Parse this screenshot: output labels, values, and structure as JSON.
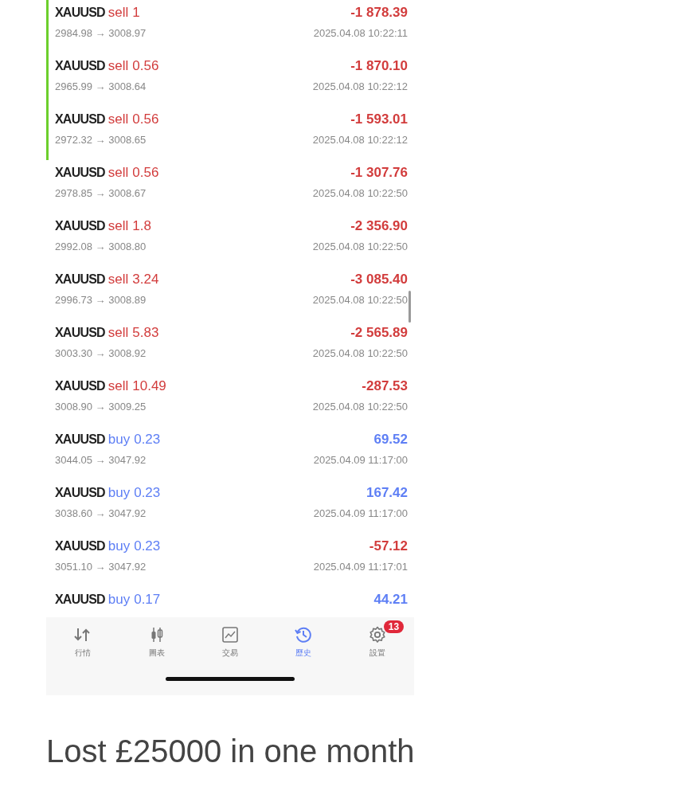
{
  "trades": [
    {
      "symbol": "XAUUSD",
      "side": "sell",
      "volume": "1",
      "profit": "-1 878.39",
      "loss": true,
      "prices": "2984.98 → 3008.97",
      "time": "2025.04.08 10:22:11",
      "flagged": true
    },
    {
      "symbol": "XAUUSD",
      "side": "sell",
      "volume": "0.56",
      "profit": "-1 870.10",
      "loss": true,
      "prices": "2965.99 → 3008.64",
      "time": "2025.04.08 10:22:12",
      "flagged": true
    },
    {
      "symbol": "XAUUSD",
      "side": "sell",
      "volume": "0.56",
      "profit": "-1 593.01",
      "loss": true,
      "prices": "2972.32 → 3008.65",
      "time": "2025.04.08 10:22:12",
      "flagged": true
    },
    {
      "symbol": "XAUUSD",
      "side": "sell",
      "volume": "0.56",
      "profit": "-1 307.76",
      "loss": true,
      "prices": "2978.85 → 3008.67",
      "time": "2025.04.08 10:22:50",
      "flagged": false
    },
    {
      "symbol": "XAUUSD",
      "side": "sell",
      "volume": "1.8",
      "profit": "-2 356.90",
      "loss": true,
      "prices": "2992.08 → 3008.80",
      "time": "2025.04.08 10:22:50",
      "flagged": false
    },
    {
      "symbol": "XAUUSD",
      "side": "sell",
      "volume": "3.24",
      "profit": "-3 085.40",
      "loss": true,
      "prices": "2996.73 → 3008.89",
      "time": "2025.04.08 10:22:50",
      "flagged": false
    },
    {
      "symbol": "XAUUSD",
      "side": "sell",
      "volume": "5.83",
      "profit": "-2 565.89",
      "loss": true,
      "prices": "3003.30 → 3008.92",
      "time": "2025.04.08 10:22:50",
      "flagged": false
    },
    {
      "symbol": "XAUUSD",
      "side": "sell",
      "volume": "10.49",
      "profit": "-287.53",
      "loss": true,
      "prices": "3008.90 → 3009.25",
      "time": "2025.04.08 10:22:50",
      "flagged": false
    },
    {
      "symbol": "XAUUSD",
      "side": "buy",
      "volume": "0.23",
      "profit": "69.52",
      "loss": false,
      "prices": "3044.05 → 3047.92",
      "time": "2025.04.09 11:17:00",
      "flagged": false
    },
    {
      "symbol": "XAUUSD",
      "side": "buy",
      "volume": "0.23",
      "profit": "167.42",
      "loss": false,
      "prices": "3038.60 → 3047.92",
      "time": "2025.04.09 11:17:00",
      "flagged": false
    },
    {
      "symbol": "XAUUSD",
      "side": "buy",
      "volume": "0.23",
      "profit": "-57.12",
      "loss": true,
      "prices": "3051.10 → 3047.92",
      "time": "2025.04.09 11:17:01",
      "flagged": false
    },
    {
      "symbol": "XAUUSD",
      "side": "buy",
      "volume": "0.17",
      "profit": "44.21",
      "loss": false,
      "flagged": false
    }
  ],
  "tab_bar": [
    {
      "kind": "quotes",
      "label": "行情",
      "selected": false
    },
    {
      "kind": "chart",
      "label": "圖表",
      "selected": false
    },
    {
      "kind": "trade",
      "label": "交易",
      "selected": false
    },
    {
      "kind": "history",
      "label": "歷史",
      "selected": true
    },
    {
      "kind": "settings",
      "label": "設置",
      "selected": false,
      "badge": "13"
    }
  ],
  "caption": "Lost £25000 in one month"
}
